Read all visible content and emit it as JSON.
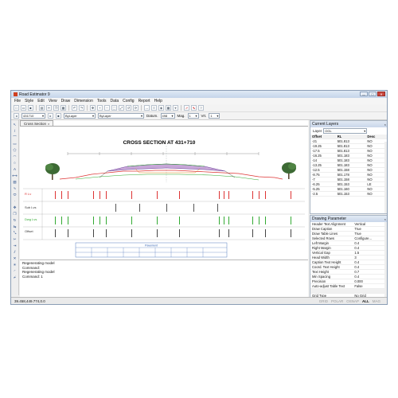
{
  "window": {
    "title": "Road Estimator 9",
    "controls": [
      "—",
      "□",
      "✕"
    ]
  },
  "menu": [
    "File",
    "Style",
    "Edit",
    "View",
    "Draw",
    "Dimension",
    "Tools",
    "Data",
    "Config",
    "Report",
    "Help"
  ],
  "toolbar2": {
    "chainage": "431710",
    "layer": "ByLayer",
    "linetype": "ByLayer",
    "datum_label": "Datum.",
    "datum_value": "498",
    "mag_label": "Mag.",
    "mag_value": "1",
    "vert_label": "Vrt.",
    "vert_value": "1"
  },
  "doc_tab": "Cross Section",
  "drawing": {
    "title": "CROSS SECTION AT 431+710",
    "rows": [
      "R Lv",
      "Sub Lvs",
      "Dwg Lvs",
      "Offset"
    ],
    "table_header": "Pavement"
  },
  "command_lines": [
    "Regenerating model",
    "Command:",
    "Regenerating model",
    "Command: 1"
  ],
  "status": {
    "coords": "39.458,449.774,0.0",
    "modes": [
      "GRID",
      "POLAR",
      "OSNAP",
      "ALL",
      "MAG"
    ],
    "active_mode": "ALL"
  },
  "layers_panel": {
    "title": "Current Layers",
    "layer_label": "Layer",
    "layer_value": "OGL",
    "columns": [
      "Offset",
      "RL",
      "Desc"
    ],
    "rows": [
      [
        "-21",
        "501.813",
        "NO"
      ],
      [
        "-19.25",
        "501.813",
        "NO"
      ],
      [
        "-17.5",
        "501.813",
        "NO"
      ],
      [
        "-16.25",
        "501.183",
        "NO"
      ],
      [
        "-14",
        "501.183",
        "NO"
      ],
      [
        "-13.25",
        "501.183",
        "NO"
      ],
      [
        "-12.5",
        "501.158",
        "NO"
      ],
      [
        "-8.75",
        "501.178",
        "NO"
      ],
      [
        "-7",
        "501.158",
        "NO"
      ],
      [
        "-6.25",
        "501.153",
        "LE"
      ],
      [
        "-5.25",
        "501.160",
        "NO"
      ],
      [
        "-2.5",
        "501.153",
        "NO"
      ]
    ]
  },
  "params_panel": {
    "title": "Drawing Parameter",
    "rows": [
      [
        "Header Text Alignment",
        "Vertical"
      ],
      [
        "Draw Caption",
        "True"
      ],
      [
        "Draw Table Lines",
        "True"
      ],
      [
        "Selected Rows",
        "Configure..."
      ],
      [
        "Left Margin",
        "0.4"
      ],
      [
        "Right Margin",
        "0.4"
      ],
      [
        "Vertical Gap",
        "1.5"
      ],
      [
        "Head Width",
        "3"
      ],
      [
        "Caption Text Height",
        "0.4"
      ],
      [
        "Coord. Text Height",
        "0.4"
      ],
      [
        "Text Height",
        "0.7"
      ],
      [
        "Min Spacing",
        "0.4"
      ],
      [
        "Precision",
        "0.000"
      ],
      [
        "Auto-adjust Table Text",
        "False"
      ],
      [
        "",
        ""
      ],
      [
        "Grid Type",
        "No Grid"
      ],
      [
        "Grid Spacing",
        "5"
      ]
    ]
  }
}
